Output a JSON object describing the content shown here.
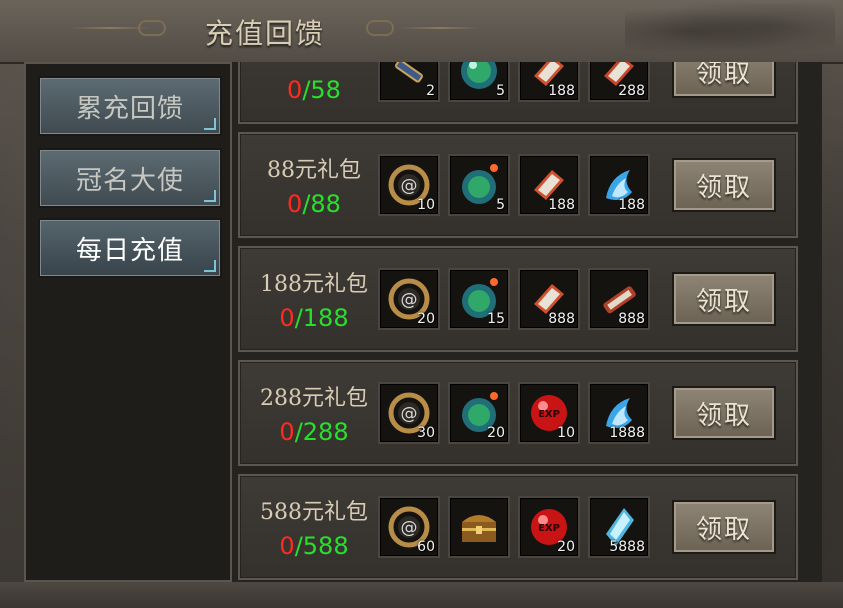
{
  "window": {
    "title": "充值回馈"
  },
  "sidebar": {
    "items": [
      {
        "label": "累充回馈",
        "active": false
      },
      {
        "label": "冠名大使",
        "active": false
      },
      {
        "label": "每日充值",
        "active": true
      }
    ]
  },
  "rows": [
    {
      "title": "",
      "current": "0",
      "goal": "58",
      "items": [
        {
          "icon": "scroll-icon",
          "qty": "2"
        },
        {
          "icon": "green-orb-icon",
          "qty": "5"
        },
        {
          "icon": "red-gem-icon",
          "qty": "188"
        },
        {
          "icon": "red-gem-icon",
          "qty": "288"
        }
      ],
      "claim_label": "领取"
    },
    {
      "title": "88元礼包",
      "current": "0",
      "goal": "88",
      "items": [
        {
          "icon": "gold-ring-icon",
          "qty": "10"
        },
        {
          "icon": "green-orb-icon",
          "qty": "5"
        },
        {
          "icon": "red-gem-icon",
          "qty": "188"
        },
        {
          "icon": "blue-flame-icon",
          "qty": "188"
        }
      ],
      "claim_label": "领取"
    },
    {
      "title": "188元礼包",
      "current": "0",
      "goal": "188",
      "items": [
        {
          "icon": "gold-ring-icon",
          "qty": "20"
        },
        {
          "icon": "green-orb-icon",
          "qty": "15"
        },
        {
          "icon": "red-gem-icon",
          "qty": "888"
        },
        {
          "icon": "red-scroll-icon",
          "qty": "888"
        }
      ],
      "claim_label": "领取"
    },
    {
      "title": "288元礼包",
      "current": "0",
      "goal": "288",
      "items": [
        {
          "icon": "gold-ring-icon",
          "qty": "30"
        },
        {
          "icon": "green-orb-icon",
          "qty": "20"
        },
        {
          "icon": "exp-orb-icon",
          "qty": "10"
        },
        {
          "icon": "blue-flame-icon",
          "qty": "1888"
        }
      ],
      "claim_label": "领取"
    },
    {
      "title": "588元礼包",
      "current": "0",
      "goal": "588",
      "items": [
        {
          "icon": "gold-ring-icon",
          "qty": "60"
        },
        {
          "icon": "treasure-chest-icon",
          "qty": ""
        },
        {
          "icon": "exp-orb-icon",
          "qty": "20"
        },
        {
          "icon": "blue-crystal-icon",
          "qty": "5888"
        }
      ],
      "claim_label": "领取"
    }
  ],
  "icon_colors": {
    "progress_current": "#ff2a1f",
    "progress_goal": "#27e02c"
  }
}
